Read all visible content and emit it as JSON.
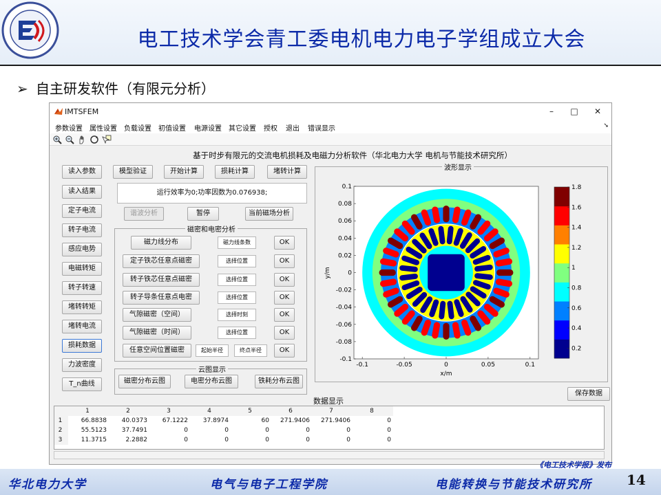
{
  "slide": {
    "title": "电工技术学会青工委电机电力电子学组成立大会",
    "bullet": "自主研发软件（有限元分析）",
    "footer_left": "华北电力大学",
    "footer_center": "电气与电子工程学院",
    "footer_right": "电能转换与节能技术研究所",
    "publish_note": "《电工技术学报》发布",
    "page_number": "14"
  },
  "window": {
    "title": "IMTSFEM",
    "controls": [
      "–",
      "□",
      "✕"
    ],
    "menu": [
      "参数设置",
      "属性设置",
      "负载设置",
      "初值设置",
      "电源设置",
      "其它设置",
      "授权",
      "退出",
      "错误显示"
    ],
    "heading": "基于时步有限元的交流电机损耗及电磁力分析软件（华北电力大学 电机与节能技术研究所）"
  },
  "left_buttons": [
    "读入参数",
    "读入结果",
    "定子电流",
    "转子电流",
    "感应电势",
    "电磁转矩",
    "转子转速",
    "堵转转矩",
    "堵转电流",
    "损耗数据",
    "力波密度",
    "T_n曲线"
  ],
  "top_buttons": [
    "模型验证",
    "开始计算",
    "损耗计算",
    "堵转计算"
  ],
  "status_text": "运行效率为0;功率因数为0.076938;",
  "action_buttons": [
    "谐波分析",
    "暂停",
    "当前磁场分析"
  ],
  "flux_group": {
    "title": "磁密和电密分析",
    "rows": [
      {
        "label": "磁力线分布",
        "field": "磁力线条数",
        "ok": "OK"
      },
      {
        "label": "定子铁芯任意点磁密",
        "field": "选择位置",
        "ok": "OK"
      },
      {
        "label": "转子铁芯任意点磁密",
        "field": "选择位置",
        "ok": "OK"
      },
      {
        "label": "转子导条任意点电密",
        "field": "选择位置",
        "ok": "OK"
      },
      {
        "label": "气隙磁密（空间）",
        "field": "选择时刻",
        "ok": "OK"
      },
      {
        "label": "气隙磁密（时间）",
        "field": "选择位置",
        "ok": "OK"
      }
    ],
    "last_row": {
      "label": "任意空间位置磁密",
      "field1": "起始半径",
      "field2": "终点半径",
      "ok": "OK"
    }
  },
  "cloud_group": {
    "title": "云图显示",
    "buttons": [
      "磁密分布云图",
      "电密分布云图",
      "铁耗分布云图"
    ]
  },
  "waveform": {
    "title": "波形显示",
    "save_button": "保存数据"
  },
  "chart_data": {
    "type": "heatmap",
    "title": "",
    "xlabel": "x/m",
    "ylabel": "y/m",
    "xlim": [
      -0.11,
      0.11
    ],
    "ylim": [
      -0.1,
      0.1
    ],
    "x_ticks": [
      "-0.1",
      "-0.05",
      "0",
      "0.05",
      "0.1"
    ],
    "y_ticks": [
      "0.1",
      "0.08",
      "0.06",
      "0.04",
      "0.02",
      "0",
      "-0.02",
      "-0.04",
      "-0.06",
      "-0.08",
      "-0.1"
    ],
    "colorbar": {
      "min": 0.1,
      "max": 1.8,
      "ticks": [
        "1.8",
        "1.6",
        "1.4",
        "1.2",
        "1",
        "0.8",
        "0.6",
        "0.4",
        "0.2"
      ]
    },
    "colormap": [
      "#00008f",
      "#0000ff",
      "#0080ff",
      "#00ffff",
      "#80ff80",
      "#ffff00",
      "#ff8000",
      "#ff0000",
      "#800000"
    ]
  },
  "data_table": {
    "title": "数据显示",
    "columns": [
      "1",
      "2",
      "3",
      "4",
      "5",
      "6",
      "7",
      "8"
    ],
    "rows": [
      {
        "index": "1",
        "values": [
          "66.8838",
          "40.0373",
          "67.1222",
          "37.8974",
          "60",
          "271.9406",
          "271.9406",
          "0"
        ]
      },
      {
        "index": "2",
        "values": [
          "55.5123",
          "37.7491",
          "0",
          "0",
          "0",
          "0",
          "0",
          "0"
        ]
      },
      {
        "index": "3",
        "values": [
          "11.3715",
          "2.2882",
          "0",
          "0",
          "0",
          "0",
          "0",
          "0"
        ]
      }
    ]
  }
}
